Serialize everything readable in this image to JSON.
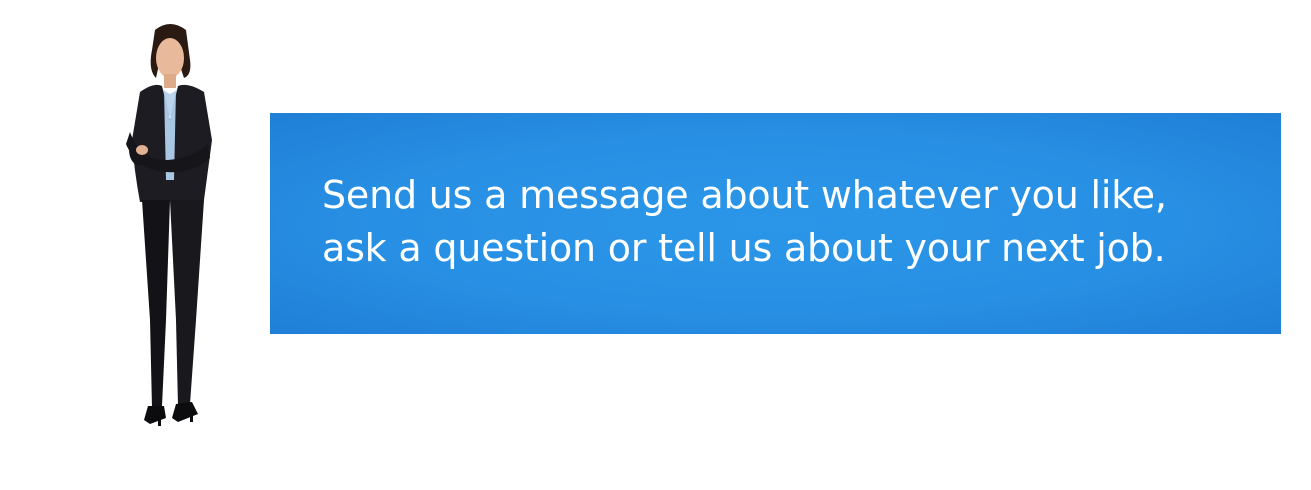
{
  "banner": {
    "message": "Send us a message about whatever you like,\nask a question or tell us about your next job.",
    "background_color": "#2890e4",
    "text_color": "#ffffff"
  },
  "figure": {
    "icon": "businesswoman-figure"
  }
}
